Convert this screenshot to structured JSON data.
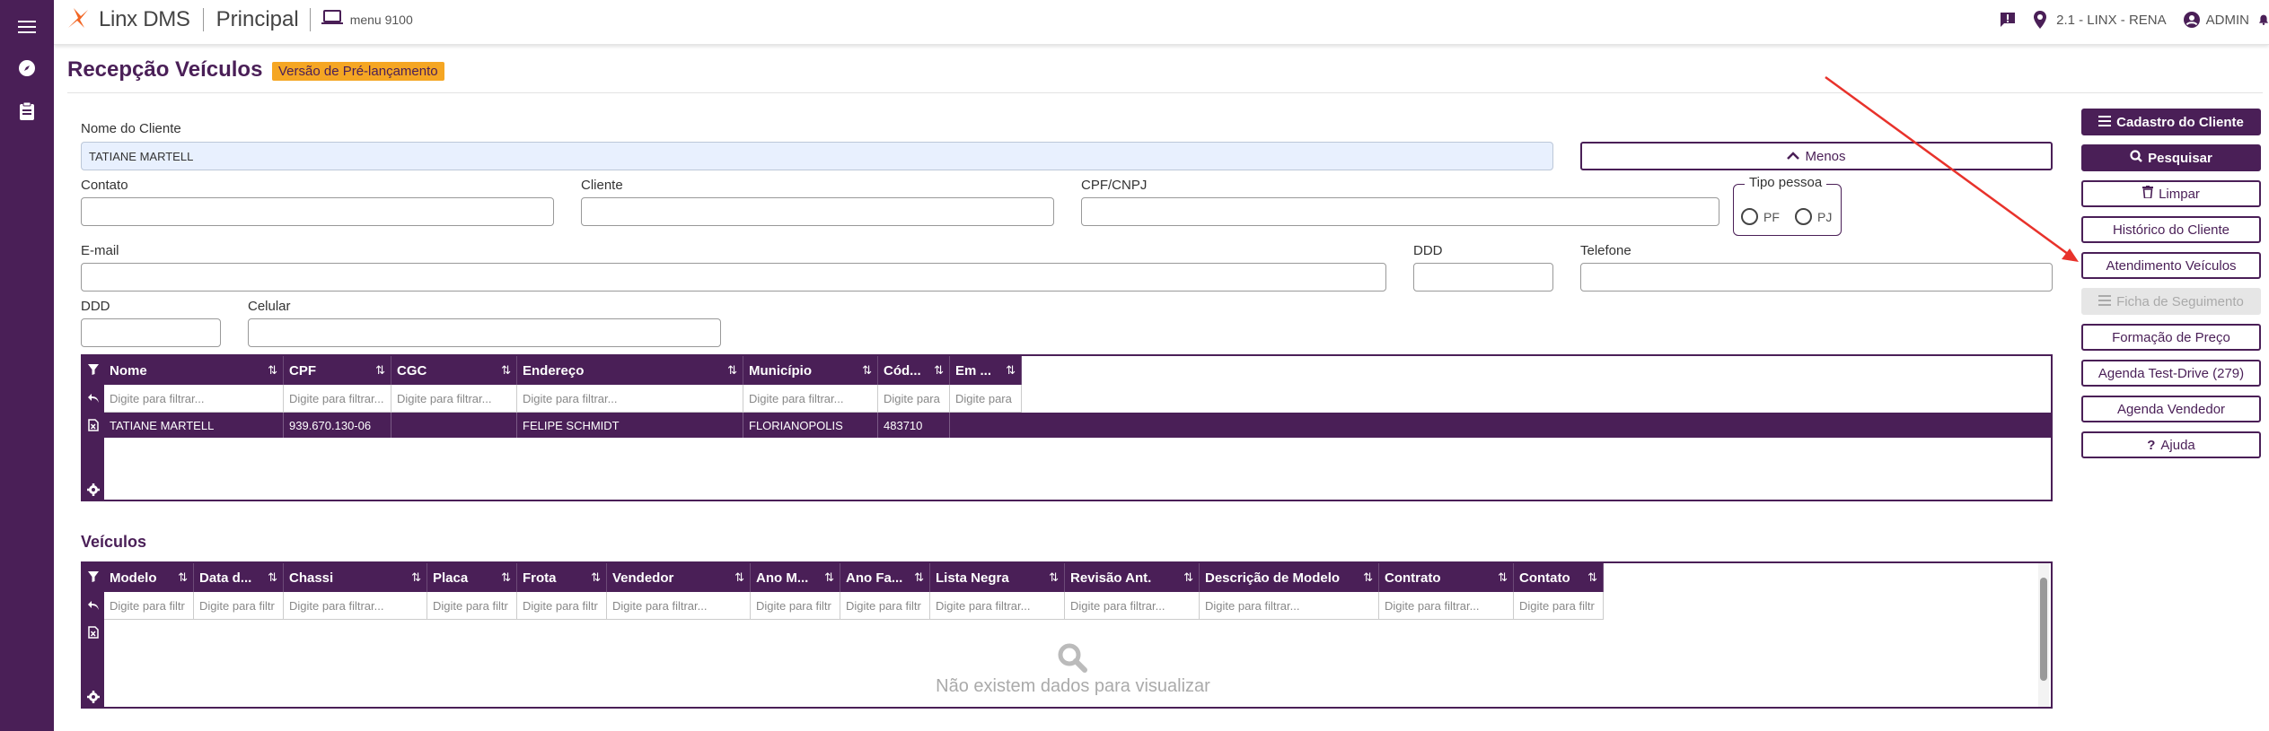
{
  "topbar": {
    "app_name": "Linx DMS",
    "module": "Principal",
    "menu_code": "menu 9100",
    "location": "2.1 - LINX - RENA",
    "user": "ADMIN",
    "icons": [
      "menu-icon",
      "compass-icon",
      "clipboard-icon",
      "laptop-icon",
      "feedback-icon",
      "location-pin-icon",
      "account-icon",
      "bell-icon"
    ]
  },
  "page": {
    "title": "Recepção Veículos",
    "badge": "Versão de Pré-lançamento"
  },
  "form": {
    "nome_cliente_label": "Nome do Cliente",
    "nome_cliente_value": "TATIANE MARTELL",
    "menos_label": "Menos",
    "contato_label": "Contato",
    "cliente_label": "Cliente",
    "cpf_label": "CPF/CNPJ",
    "tipo_pessoa_label": "Tipo pessoa",
    "pf_label": "PF",
    "pj_label": "PJ",
    "email_label": "E-mail",
    "ddd1_label": "DDD",
    "telefone_label": "Telefone",
    "ddd2_label": "DDD",
    "celular_label": "Celular"
  },
  "clients_grid": {
    "columns": [
      "Nome",
      "CPF",
      "CGC",
      "Endereço",
      "Município",
      "Cód...",
      "Em ..."
    ],
    "filter_placeholders": [
      "Digite para filtrar...",
      "Digite para filtrar...",
      "Digite para filtrar...",
      "Digite para filtrar...",
      "Digite para filtrar...",
      "Digite para",
      "Digite para"
    ],
    "rows": [
      [
        "TATIANE MARTELL",
        "939.670.130-06",
        "",
        "FELIPE SCHMIDT",
        "FLORIANOPOLIS",
        "483710",
        ""
      ]
    ]
  },
  "vehicles": {
    "title": "Veículos",
    "columns": [
      "Modelo",
      "Data d...",
      "Chassi",
      "Placa",
      "Frota",
      "Vendedor",
      "Ano M...",
      "Ano Fa...",
      "Lista Negra",
      "Revisão Ant.",
      "Descrição de Modelo",
      "Contrato",
      "Contato"
    ],
    "filter_placeholders": [
      "Digite para filtr",
      "Digite para filtr",
      "Digite para filtrar...",
      "Digite para filtr",
      "Digite para filtr",
      "Digite para filtrar...",
      "Digite para filtr",
      "Digite para filtr",
      "Digite para filtrar...",
      "Digite para filtrar...",
      "Digite para filtrar...",
      "Digite para filtrar...",
      "Digite para filtr"
    ],
    "empty_message": "Não existem dados para visualizar"
  },
  "actions": {
    "cadastro": "Cadastro do Cliente",
    "pesquisar": "Pesquisar",
    "limpar": "Limpar",
    "historico": "Histórico do Cliente",
    "atendimento": "Atendimento Veículos",
    "ficha": "Ficha de Seguimento",
    "formacao": "Formação de Preço",
    "agenda_test": "Agenda Test-Drive (279)",
    "agenda_vendedor": "Agenda Vendedor",
    "ajuda": "Ajuda"
  },
  "colors": {
    "primary": "#4a1f57",
    "badge": "#f5a623",
    "annotation_arrow": "#e8322b"
  }
}
